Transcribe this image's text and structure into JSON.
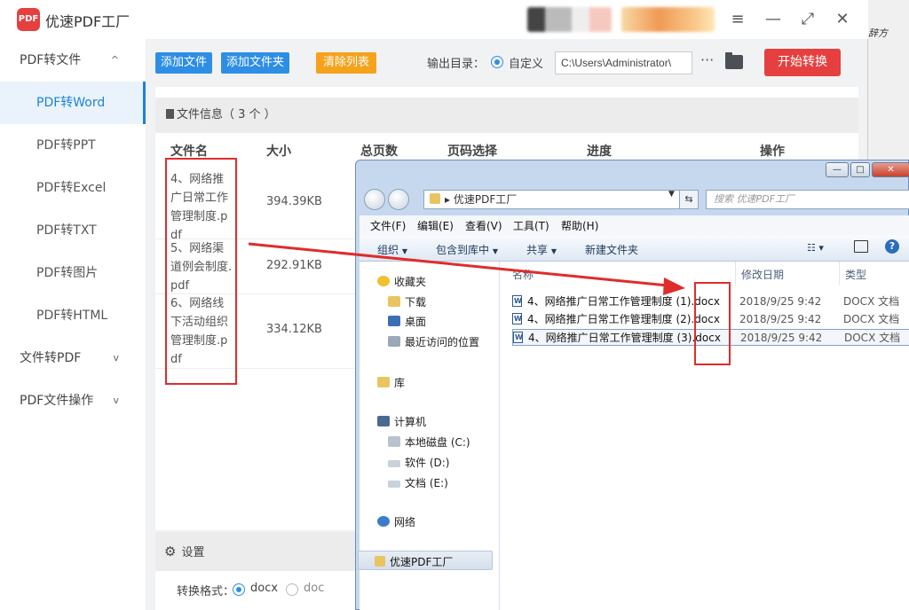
{
  "app": {
    "title": "优速PDF工厂",
    "logo_text": "PDF",
    "window_controls": [
      "≡",
      "—",
      "⤢",
      "✕"
    ]
  },
  "sidebar": {
    "groups": [
      {
        "label": "PDF转文件",
        "chevron": "^"
      },
      {
        "label": "文件转PDF",
        "chevron": "v"
      },
      {
        "label": "PDF文件操作",
        "chevron": "v"
      }
    ],
    "items": [
      {
        "label": "PDF转Word",
        "active": true
      },
      {
        "label": "PDF转PPT"
      },
      {
        "label": "PDF转Excel"
      },
      {
        "label": "PDF转TXT"
      },
      {
        "label": "PDF转图片"
      },
      {
        "label": "PDF转HTML"
      }
    ]
  },
  "toolbar": {
    "add_file": "添加文件",
    "add_folder": "添加文件夹",
    "clear_list": "清除列表",
    "output_label": "输出目录：",
    "custom_label": "自定义",
    "output_path": "C:\\Users\\Administrator\\",
    "more": "···",
    "start": "开始转换"
  },
  "file_panel": {
    "info_label": "文件信息（ 3 个 ）",
    "columns": [
      "文件名",
      "大小",
      "总页数",
      "页码选择",
      "进度",
      "操作"
    ],
    "rows": [
      {
        "name": "4、网络推广日常工作管理制度.pdf",
        "size": "394.39KB"
      },
      {
        "name": "5、网络渠道例会制度.pdf",
        "size": "292.91KB"
      },
      {
        "name": "6、网络线下活动组织管理制度.pdf",
        "size": "334.12KB"
      }
    ]
  },
  "settings": {
    "label": "设置",
    "format_label": "转换格式：",
    "format_options": [
      "docx",
      "doc"
    ],
    "selected_format": "docx"
  },
  "right_strip": {
    "text": "辞方"
  },
  "explorer": {
    "window_controls": [
      "—",
      "□",
      "✕"
    ],
    "address_chevron": "▸",
    "address": "优速PDF工厂",
    "search_placeholder": "搜索 优速PDF工厂",
    "menu": [
      "文件(F)",
      "编辑(E)",
      "查看(V)",
      "工具(T)",
      "帮助(H)"
    ],
    "commands": [
      "组织",
      "包含到库中",
      "共享",
      "新建文件夹"
    ],
    "nav": {
      "favorites": "收藏夹",
      "downloads": "下载",
      "desktop": "桌面",
      "recent": "最近访问的位置",
      "libraries": "库",
      "computer": "计算机",
      "drive_c": "本地磁盘 (C:)",
      "drive_d": "软件 (D:)",
      "drive_e": "文档 (E:)",
      "network": "网络",
      "selected_folder": "优速PDF工厂"
    },
    "columns": [
      "名称",
      "修改日期",
      "类型"
    ],
    "files": [
      {
        "name": "4、网络推广日常工作管理制度 (1).docx",
        "date": "2018/9/25 9:42",
        "type": "DOCX 文档"
      },
      {
        "name": "4、网络推广日常工作管理制度 (2).docx",
        "date": "2018/9/25 9:42",
        "type": "DOCX 文档"
      },
      {
        "name": "4、网络推广日常工作管理制度 (3).docx",
        "date": "2018/9/25 9:42",
        "type": "DOCX 文档"
      }
    ]
  },
  "colors": {
    "accent_blue": "#2e8ee6",
    "accent_red": "#e5403f",
    "accent_orange": "#f6a21c",
    "annotation_red": "#e02c2c"
  }
}
